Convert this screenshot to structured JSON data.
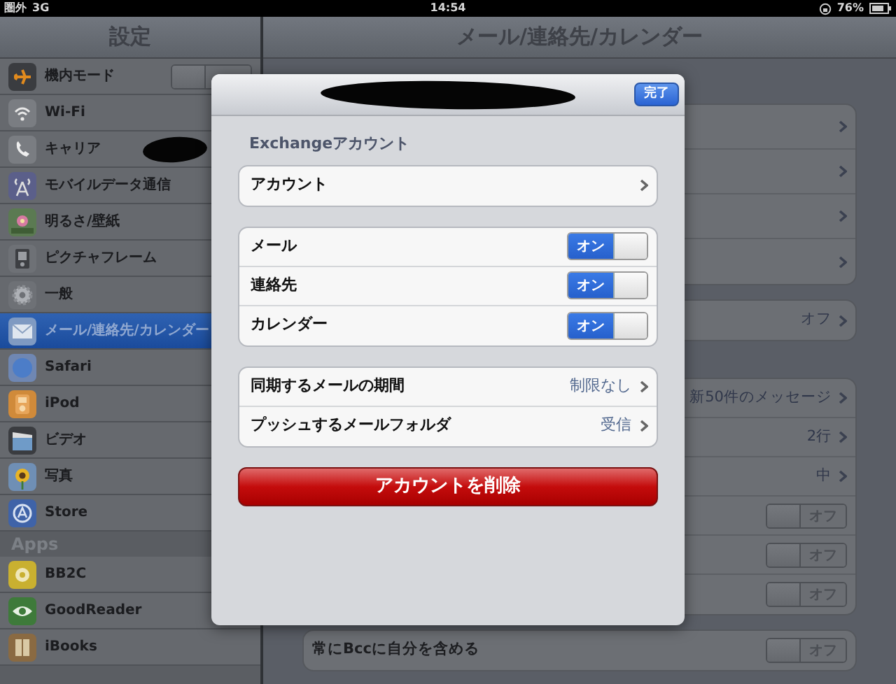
{
  "status_bar": {
    "carrier": "圏外",
    "network": "3G",
    "time": "14:54",
    "battery": "76%"
  },
  "sidebar": {
    "title": "設定",
    "items": [
      {
        "label": "機内モード",
        "kind": "toggle",
        "on": false,
        "selected": false
      },
      {
        "label": "Wi-Fi",
        "selected": false
      },
      {
        "label": "キャリア",
        "kind": "redacted",
        "selected": false
      },
      {
        "label": "モバイルデータ通信",
        "selected": false
      },
      {
        "label": "明るさ/壁紙",
        "selected": false
      },
      {
        "label": "ピクチャフレーム",
        "selected": false
      },
      {
        "label": "一般",
        "selected": false
      },
      {
        "label": "メール/連絡先/カレンダー",
        "selected": true
      },
      {
        "label": "Safari",
        "selected": false
      },
      {
        "label": "iPod",
        "selected": false
      },
      {
        "label": "ビデオ",
        "selected": false
      },
      {
        "label": "写真",
        "selected": false
      },
      {
        "label": "Store",
        "selected": false
      }
    ],
    "apps_header": "Apps",
    "apps": [
      {
        "label": "BB2C",
        "selected": false
      },
      {
        "label": "GoodReader",
        "selected": false
      },
      {
        "label": "iBooks",
        "selected": false
      }
    ]
  },
  "detail": {
    "title": "メール/連絡先/カレンダー",
    "groups": [
      {
        "rows": [
          {
            "kind": "link"
          },
          {
            "kind": "link"
          },
          {
            "kind": "link"
          },
          {
            "kind": "link"
          }
        ]
      },
      {
        "rows": [
          {
            "kind": "link",
            "value": "オフ"
          }
        ]
      },
      {
        "rows": [
          {
            "kind": "link",
            "value": "新50件のメッセージ"
          },
          {
            "kind": "link",
            "value": "2行"
          },
          {
            "kind": "link",
            "value": "中"
          },
          {
            "kind": "toggle",
            "on": false,
            "switch_text": "オフ"
          },
          {
            "kind": "toggle",
            "on": false,
            "switch_text": "オフ"
          },
          {
            "kind": "toggle",
            "on": false,
            "switch_text": "オフ"
          }
        ]
      },
      {
        "rows": [
          {
            "kind": "toggle",
            "label": "常にBccに自分を含める",
            "on": false,
            "switch_text": "オフ"
          }
        ]
      }
    ]
  },
  "dialog": {
    "redacted_title": true,
    "done_button": "完了",
    "section_header": "Exchangeアカウント",
    "groups": [
      {
        "rows": [
          {
            "kind": "link",
            "label": "アカウント"
          }
        ]
      },
      {
        "rows": [
          {
            "kind": "toggle",
            "label": "メール",
            "on": true,
            "switch_text": "オン"
          },
          {
            "kind": "toggle",
            "label": "連絡先",
            "on": true,
            "switch_text": "オン"
          },
          {
            "kind": "toggle",
            "label": "カレンダー",
            "on": true,
            "switch_text": "オン"
          }
        ]
      },
      {
        "rows": [
          {
            "kind": "link",
            "label": "同期するメールの期間",
            "value": "制限なし"
          },
          {
            "kind": "link",
            "label": "プッシュするメールフォルダ",
            "value": "受信"
          }
        ]
      }
    ],
    "delete_button": "アカウントを削除"
  }
}
